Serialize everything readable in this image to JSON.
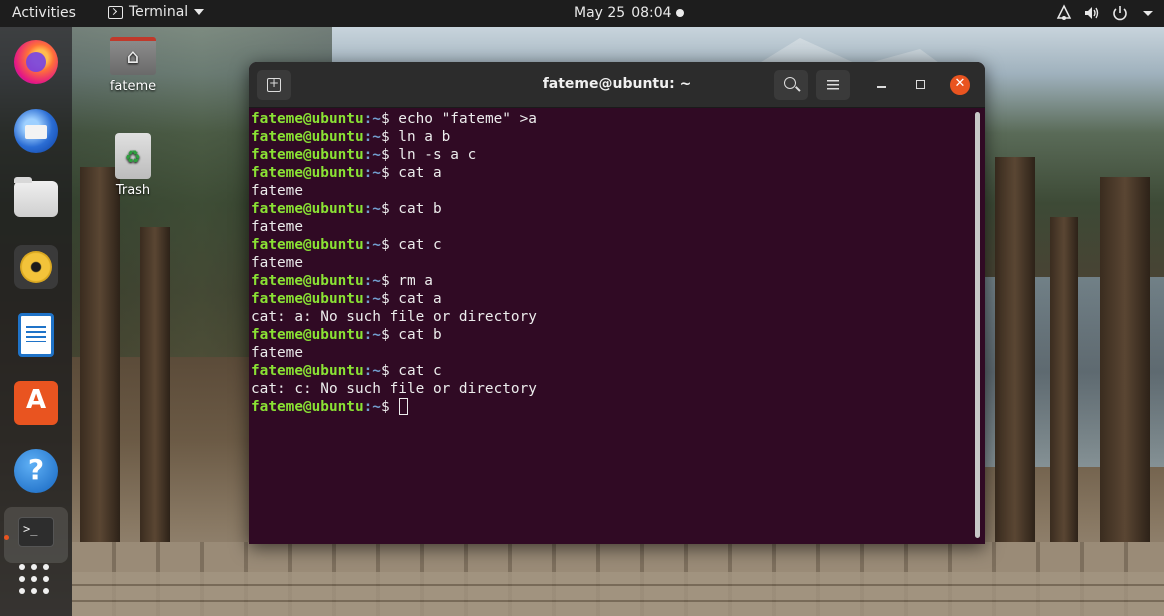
{
  "topbar": {
    "activities": "Activities",
    "app_name": "Terminal",
    "date": "May 25",
    "time": "08:04"
  },
  "desktop_icons": {
    "home_label": "fateme",
    "trash_label": "Trash"
  },
  "terminal": {
    "title": "fateme@ubuntu: ~",
    "prompt_user": "fateme@ubuntu",
    "prompt_path": ":~",
    "prompt_symbol": "$",
    "lines": [
      {
        "type": "cmd",
        "text": " echo \"fateme\" >a"
      },
      {
        "type": "cmd",
        "text": " ln a b"
      },
      {
        "type": "cmd",
        "text": " ln -s a c"
      },
      {
        "type": "cmd",
        "text": " cat a"
      },
      {
        "type": "out",
        "text": "fateme"
      },
      {
        "type": "cmd",
        "text": " cat b"
      },
      {
        "type": "out",
        "text": "fateme"
      },
      {
        "type": "cmd",
        "text": " cat c"
      },
      {
        "type": "out",
        "text": "fateme"
      },
      {
        "type": "cmd",
        "text": " rm a"
      },
      {
        "type": "cmd",
        "text": " cat a"
      },
      {
        "type": "out",
        "text": "cat: a: No such file or directory"
      },
      {
        "type": "cmd",
        "text": " cat b"
      },
      {
        "type": "out",
        "text": "fateme"
      },
      {
        "type": "cmd",
        "text": " cat c"
      },
      {
        "type": "out",
        "text": "cat: c: No such file or directory"
      },
      {
        "type": "cmd",
        "text": " ",
        "cursor": true
      }
    ]
  },
  "icons": {
    "dock": [
      "firefox-icon",
      "thunderbird-icon",
      "files-icon",
      "rhythmbox-icon",
      "libreoffice-writer-icon",
      "ubuntu-software-icon",
      "help-icon",
      "terminal-icon",
      "show-applications-icon"
    ],
    "tray": [
      "network-icon",
      "volume-icon",
      "power-icon",
      "chevron-down-icon"
    ]
  },
  "colors": {
    "terminal_bg": "#300a24",
    "prompt_user": "#8ae234",
    "prompt_path": "#729fcf",
    "accent": "#e95420"
  }
}
